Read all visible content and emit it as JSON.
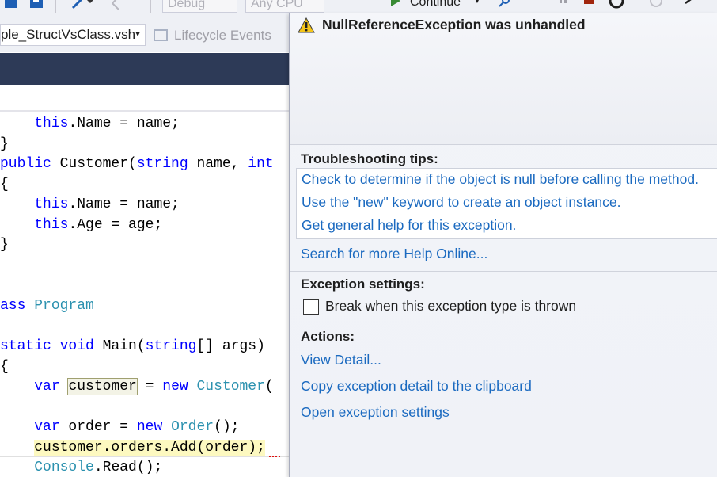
{
  "toolbar": {
    "config_value": "Debug",
    "platform_value": "Any CPU",
    "continue_label": "Continue"
  },
  "navbar": {
    "file_combo": "ple_StructVsClass.vsh",
    "lifecycle_combo": "Lifecycle Events"
  },
  "code": {
    "lines": [
      {
        "text": "    this.Name = name;"
      },
      {
        "text": "}"
      },
      {
        "text": "public Customer(string name, int"
      },
      {
        "text": "{"
      },
      {
        "text": "    this.Name = name;"
      },
      {
        "text": "    this.Age = age;"
      },
      {
        "text": "}"
      },
      {
        "text": "ass Program"
      },
      {
        "text": "static void Main(string[] args)"
      },
      {
        "text": "{"
      },
      {
        "text": "    var customer = new Customer("
      },
      {
        "text": "    var order = new Order();"
      },
      {
        "text": "    customer.orders.Add(order);"
      },
      {
        "text": "    Console.Read();"
      }
    ]
  },
  "exception": {
    "title": "NullReferenceException was unhandled",
    "troubleshooting_title": "Troubleshooting tips:",
    "tips": [
      "Check to determine if the object is null before calling the method.",
      "Use the \"new\" keyword to create an object instance.",
      "Get general help for this exception."
    ],
    "search_online": "Search for more Help Online...",
    "settings_title": "Exception settings:",
    "break_checkbox_label": "Break when this exception type is thrown",
    "break_checked": false,
    "actions_title": "Actions:",
    "actions": [
      "View Detail...",
      "Copy exception detail to the clipboard",
      "Open exception settings"
    ]
  },
  "colors": {
    "keyword": "#0000ff",
    "type": "#2b91af",
    "link": "#1b6ac0",
    "dark_band": "#2d3a57",
    "warning": "#f5c518"
  },
  "icons": [
    "save-icon",
    "redo-icon",
    "undo-icon",
    "continue-icon",
    "find-icon",
    "pause-icon",
    "stop-icon",
    "restart-icon",
    "refresh-icon",
    "step-over-icon",
    "warning-icon",
    "lifecycle-icon"
  ]
}
